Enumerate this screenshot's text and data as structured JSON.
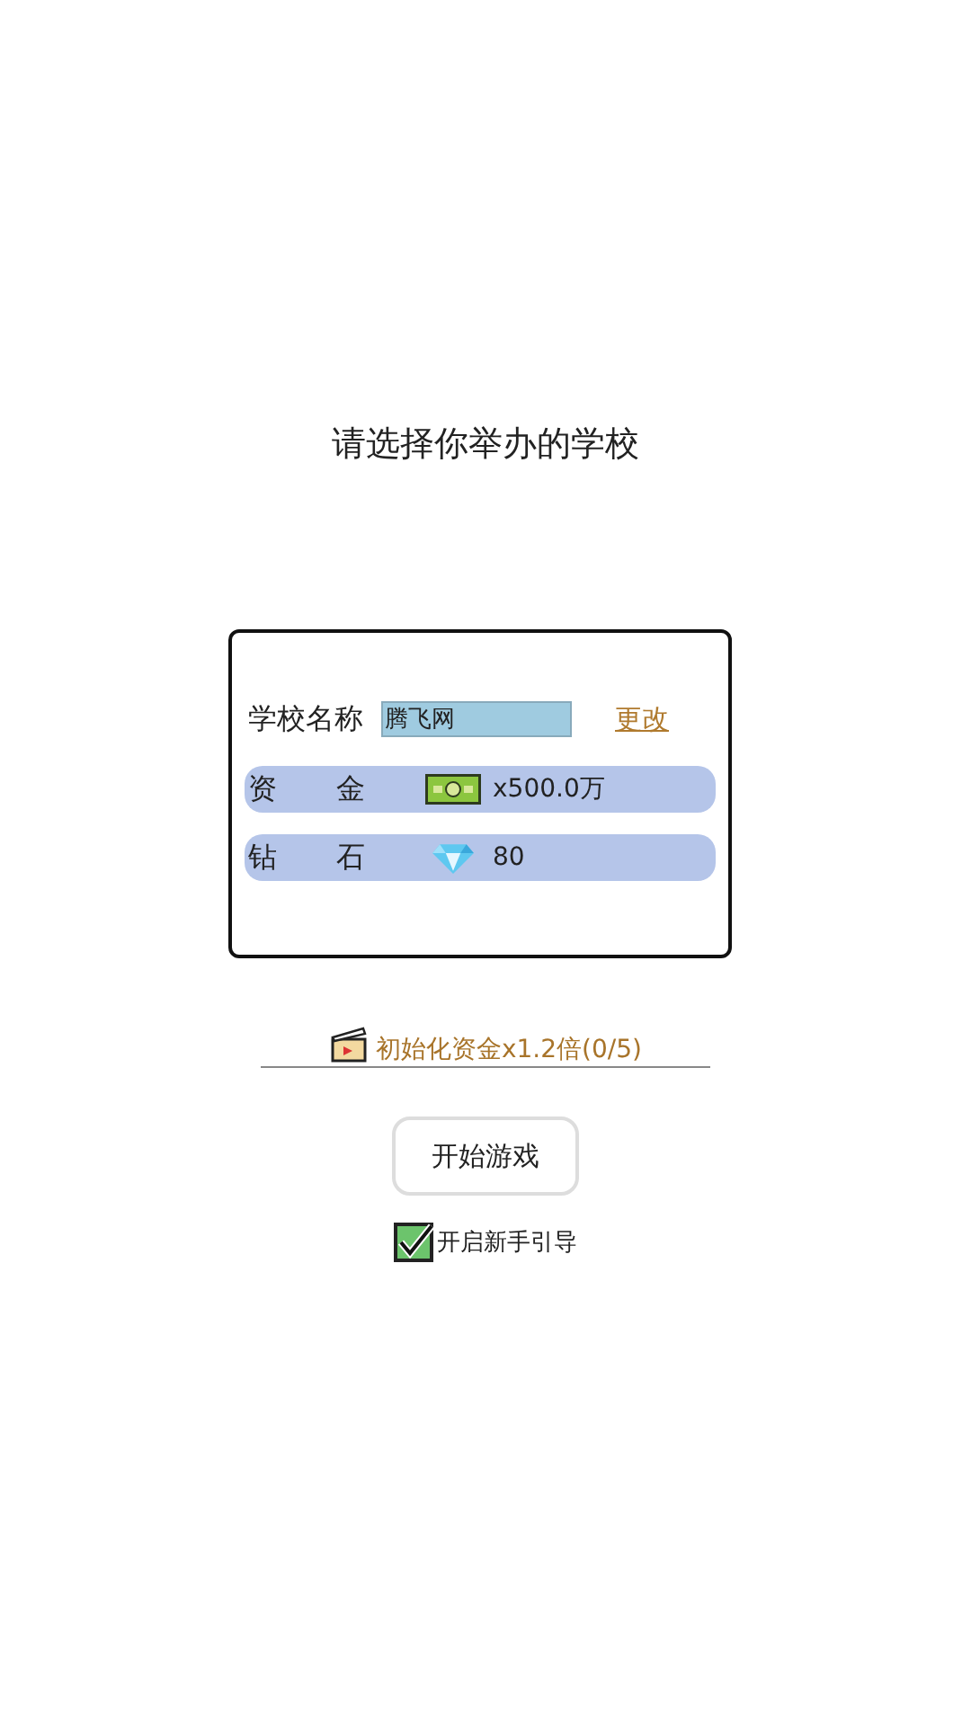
{
  "title": "请选择你举办的学校",
  "school_name": {
    "label": "学校名称",
    "value": "腾飞网",
    "change_link": "更改"
  },
  "resources": [
    {
      "kind": "money",
      "label": "资 金",
      "value": "x500.0万"
    },
    {
      "kind": "diamond",
      "label": "钻 石",
      "value": "80"
    }
  ],
  "bonus_link": "初始化资金x1.2倍(0/5)",
  "start_button": "开始游戏",
  "tutorial": {
    "label": "开启新手引导",
    "checked": true
  }
}
